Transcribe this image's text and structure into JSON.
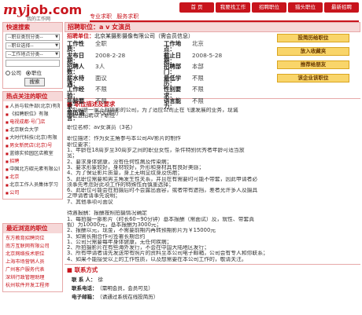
{
  "logo": {
    "brand_my": "my",
    "brand_job": "job.com",
    "tagline": "我的工作网"
  },
  "top_links": [
    "专业求职",
    "服务求职"
  ],
  "nav": [
    "首 页",
    "我要找工作",
    "招聘职位",
    "猎头职位",
    "最新招聘"
  ],
  "sidebar": {
    "search_title": "快速搜索",
    "select1": "--职业类别分类--",
    "select2": "--职业选择--",
    "select3": "--工作地点分类--",
    "radio1": "公司",
    "radio2": "职位",
    "search_button": "搜索",
    "hot_title": "热点关注的职位",
    "hot_items": [
      "人员与软件部(北京)有限公司",
      "《招聘职位》有限",
      "电视成都·号门店",
      "北京联合大学",
      "大时代科技(北京)有限",
      "男女新民店(北京)号",
      "蓝德实验园区店教室",
      "招聘",
      "中国北方碳元素有限公司",
      "北京",
      "北京工作人员集体学习",
      "公司"
    ],
    "hot_red": [
      false,
      false,
      true,
      false,
      false,
      true,
      false,
      true,
      false,
      true,
      false,
      true
    ],
    "recent_title": "最近浏览的职位",
    "recent_items": [
      "东方教育招聘岗位",
      "南方互联网有限公司",
      "北京网络技术职位",
      "上海市场营销人员",
      "广州客户服务代表",
      "深圳行政管理助理",
      "杭州软件开发工程师"
    ]
  },
  "job": {
    "title_label": "招聘职位：",
    "title_value": "a v 女演员",
    "company_label": "招聘单位：",
    "company_value": "北京某摄影摄像有限公司（需会员信息）",
    "left_fields": [
      {
        "k": "工作性质：",
        "v": "全职"
      },
      {
        "k": "发布日期：",
        "v": "2008-2-28"
      },
      {
        "k": "招聘人数：",
        "v": "3人"
      },
      {
        "k": "薪水待遇：",
        "v": "面议"
      },
      {
        "k": "工作经验：",
        "v": "不限"
      },
      {
        "k": "年龄要求：",
        "v": "不限"
      },
      {
        "k": "简历语言：",
        "v": "中文简历"
      }
    ],
    "right_fields": [
      {
        "k": "工作地点：",
        "v": "北京"
      },
      {
        "k": "截止日期：",
        "v": "2008-5-28"
      },
      {
        "k": "招聘部门：",
        "v": "本部"
      },
      {
        "k": "最低学历：",
        "v": "不限"
      },
      {
        "k": "性别要求：",
        "v": "不限"
      },
      {
        "k": "语言能力：",
        "v": "不限"
      }
    ],
    "actions": [
      "投简历给职位",
      "放入收藏夹",
      "推荐给朋友",
      "该企业该职位"
    ]
  },
  "description": {
    "title": "职位描述及要求",
    "lines": [
      "本公司是一家正规摄影的公司，为了适应公司正在飞速发展的业务，现诚",
      "向社会招聘以下职位",
      "",
      "职位名称：av女演员（3名）",
      "",
      "职位描述：作为女主角参与本公司AV影片的制作",
      "职位要求：",
      "1、年龄在18周岁至30周岁之间的职业女性，条件特别优秀者年龄可适当放",
      "宽；",
      "2、要求身体健康，没有任何性病及传染病；",
      "3、要求形象较好，身材较好，外形和身材具有良好美感；",
      "4、为了保证影片质量，身上无明显纹身及伤疤；",
      "5、此职位需要和男主角发生性关系，并且在有需要时可能不带套，因此申请者必",
      "须事先考虑好此项工作的特殊性而慎重选择；",
      "6、此职位可能会在拍摄后时不会露出面容，或者带有遮挡，差者允许多人及摄具",
      "之申请者请事先说明；",
      "7、其他事项可面议",
      "",
      "待遇报酬：报酬按照拍摄情况确定",
      "1、每拍摄一部影片（时长60~90分钟）基本报酬（需面试）及，就性、带套真",
      "假）为10000元，基本报酬为3000元；",
      "2、报酬以元，现金，不需要前期内再转预期影片为￥15000元",
      "3、如需长期合作可签署长期合约"
    ],
    "extra": [
      "1、公司只需要每年身体健康，无任何疾病；",
      "2、所拍摄影片在有些海外发行，不会在中国大陆地区发行；",
      "3、所有申请者请先发送带有照片的资料至本公司电子邮箱，公司会有专人和你联系；",
      "4、如果不能接受以上的工作性质，以及想需要在本公司工作的，敬请关注。"
    ]
  },
  "contact": {
    "title": "联系方式",
    "person_label": "联 系 人：",
    "person_value": "徐",
    "phone_label": "联系电话：",
    "phone_value": "（需明会员，会员可见）",
    "email_label": "电子邮箱：",
    "email_value": "（请通过系统在线投简历）"
  }
}
